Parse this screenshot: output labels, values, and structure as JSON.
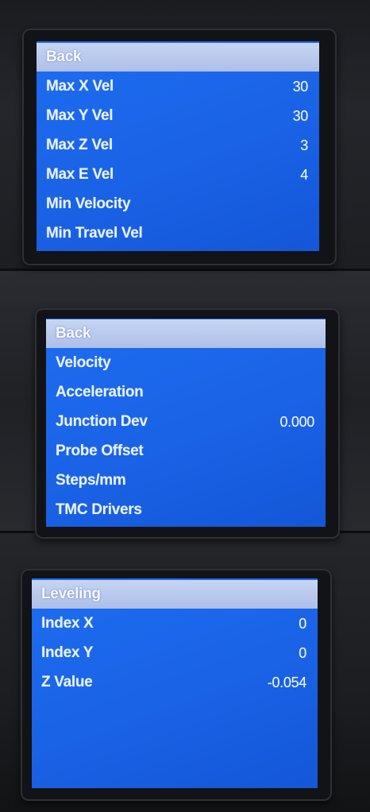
{
  "screens": [
    {
      "header": "Back",
      "items": [
        {
          "label": "Max X Vel",
          "value": "30"
        },
        {
          "label": "Max Y Vel",
          "value": "30"
        },
        {
          "label": "Max Z Vel",
          "value": "3"
        },
        {
          "label": "Max E Vel",
          "value": "4"
        },
        {
          "label": "Min Velocity",
          "value": ""
        },
        {
          "label": "Min Travel Vel",
          "value": ""
        }
      ]
    },
    {
      "header": "Back",
      "items": [
        {
          "label": "Velocity",
          "value": ""
        },
        {
          "label": "Acceleration",
          "value": ""
        },
        {
          "label": "Junction Dev",
          "value": "0.000"
        },
        {
          "label": "Probe Offset",
          "value": ""
        },
        {
          "label": "Steps/mm",
          "value": ""
        },
        {
          "label": "TMC Drivers",
          "value": ""
        }
      ]
    },
    {
      "header": "Leveling",
      "items": [
        {
          "label": "Index X",
          "value": "0"
        },
        {
          "label": "Index Y",
          "value": "0"
        },
        {
          "label": "Z Value",
          "value": "-0.054"
        }
      ]
    }
  ],
  "colors": {
    "screen_blue": "#1a62e6",
    "header_highlight": "#b8c8ee",
    "text": "#eaf2ff"
  }
}
